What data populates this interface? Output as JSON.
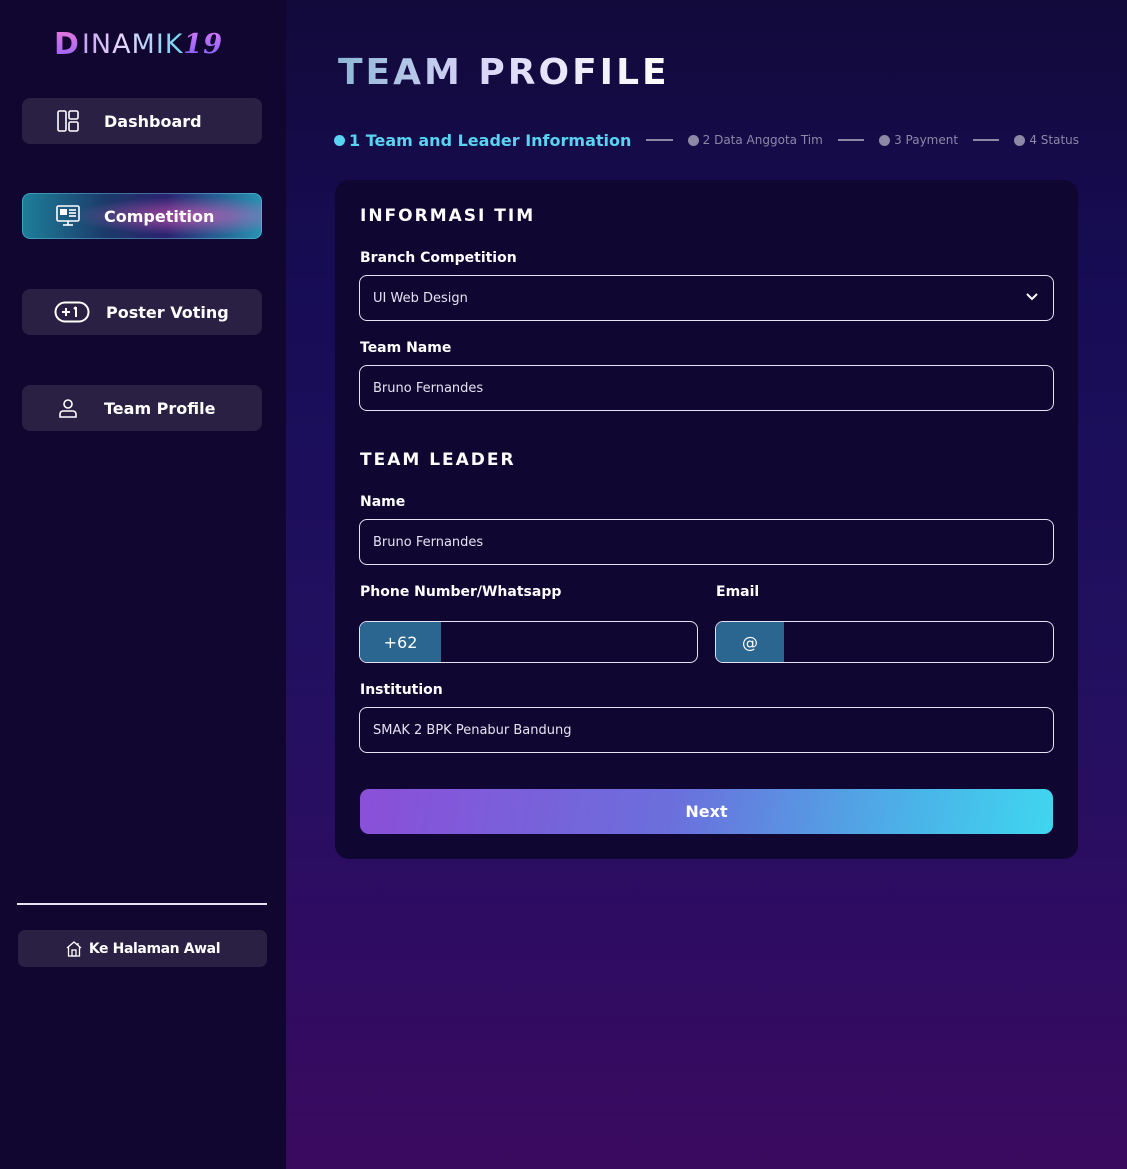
{
  "logo": {
    "first": "D",
    "rest": "INAMIK",
    "num": "19"
  },
  "sidebar": {
    "items": [
      {
        "label": "Dashboard",
        "icon": "dashboard-icon"
      },
      {
        "label": "Competition",
        "icon": "monitor-icon",
        "active": true
      },
      {
        "label": "Poster Voting",
        "icon": "plus-one-icon"
      },
      {
        "label": "Team Profile",
        "icon": "user-icon"
      }
    ],
    "home_label": "Ke Halaman Awal"
  },
  "page": {
    "title": "TEAM PROFILE"
  },
  "stepper": {
    "steps": [
      {
        "label": "1 Team and Leader Information",
        "active": true
      },
      {
        "label": "2 Data Anggota Tim"
      },
      {
        "label": "3 Payment"
      },
      {
        "label": "4 Status"
      }
    ]
  },
  "form": {
    "section_info": "INFORMASI TIM",
    "branch_label": "Branch Competition",
    "branch_value": "UI Web Design",
    "team_name_label": "Team Name",
    "team_name_value": "Bruno Fernandes",
    "section_leader": "TEAM LEADER",
    "name_label": "Name",
    "name_value": "Bruno Fernandes",
    "phone_label": "Phone Number/Whatsapp",
    "phone_prefix": "+62",
    "phone_value": "",
    "email_label": "Email",
    "email_prefix": "@",
    "email_value": "",
    "institution_label": "Institution",
    "institution_value": "SMAK 2 BPK Penabur Bandung",
    "next_label": "Next"
  },
  "colors": {
    "sidebar_bg": "#110630",
    "nav_bg": "#2a2044",
    "card_bg": "#0f0731",
    "accent": "#58d3f2",
    "prefix_bg": "#2a6690"
  }
}
